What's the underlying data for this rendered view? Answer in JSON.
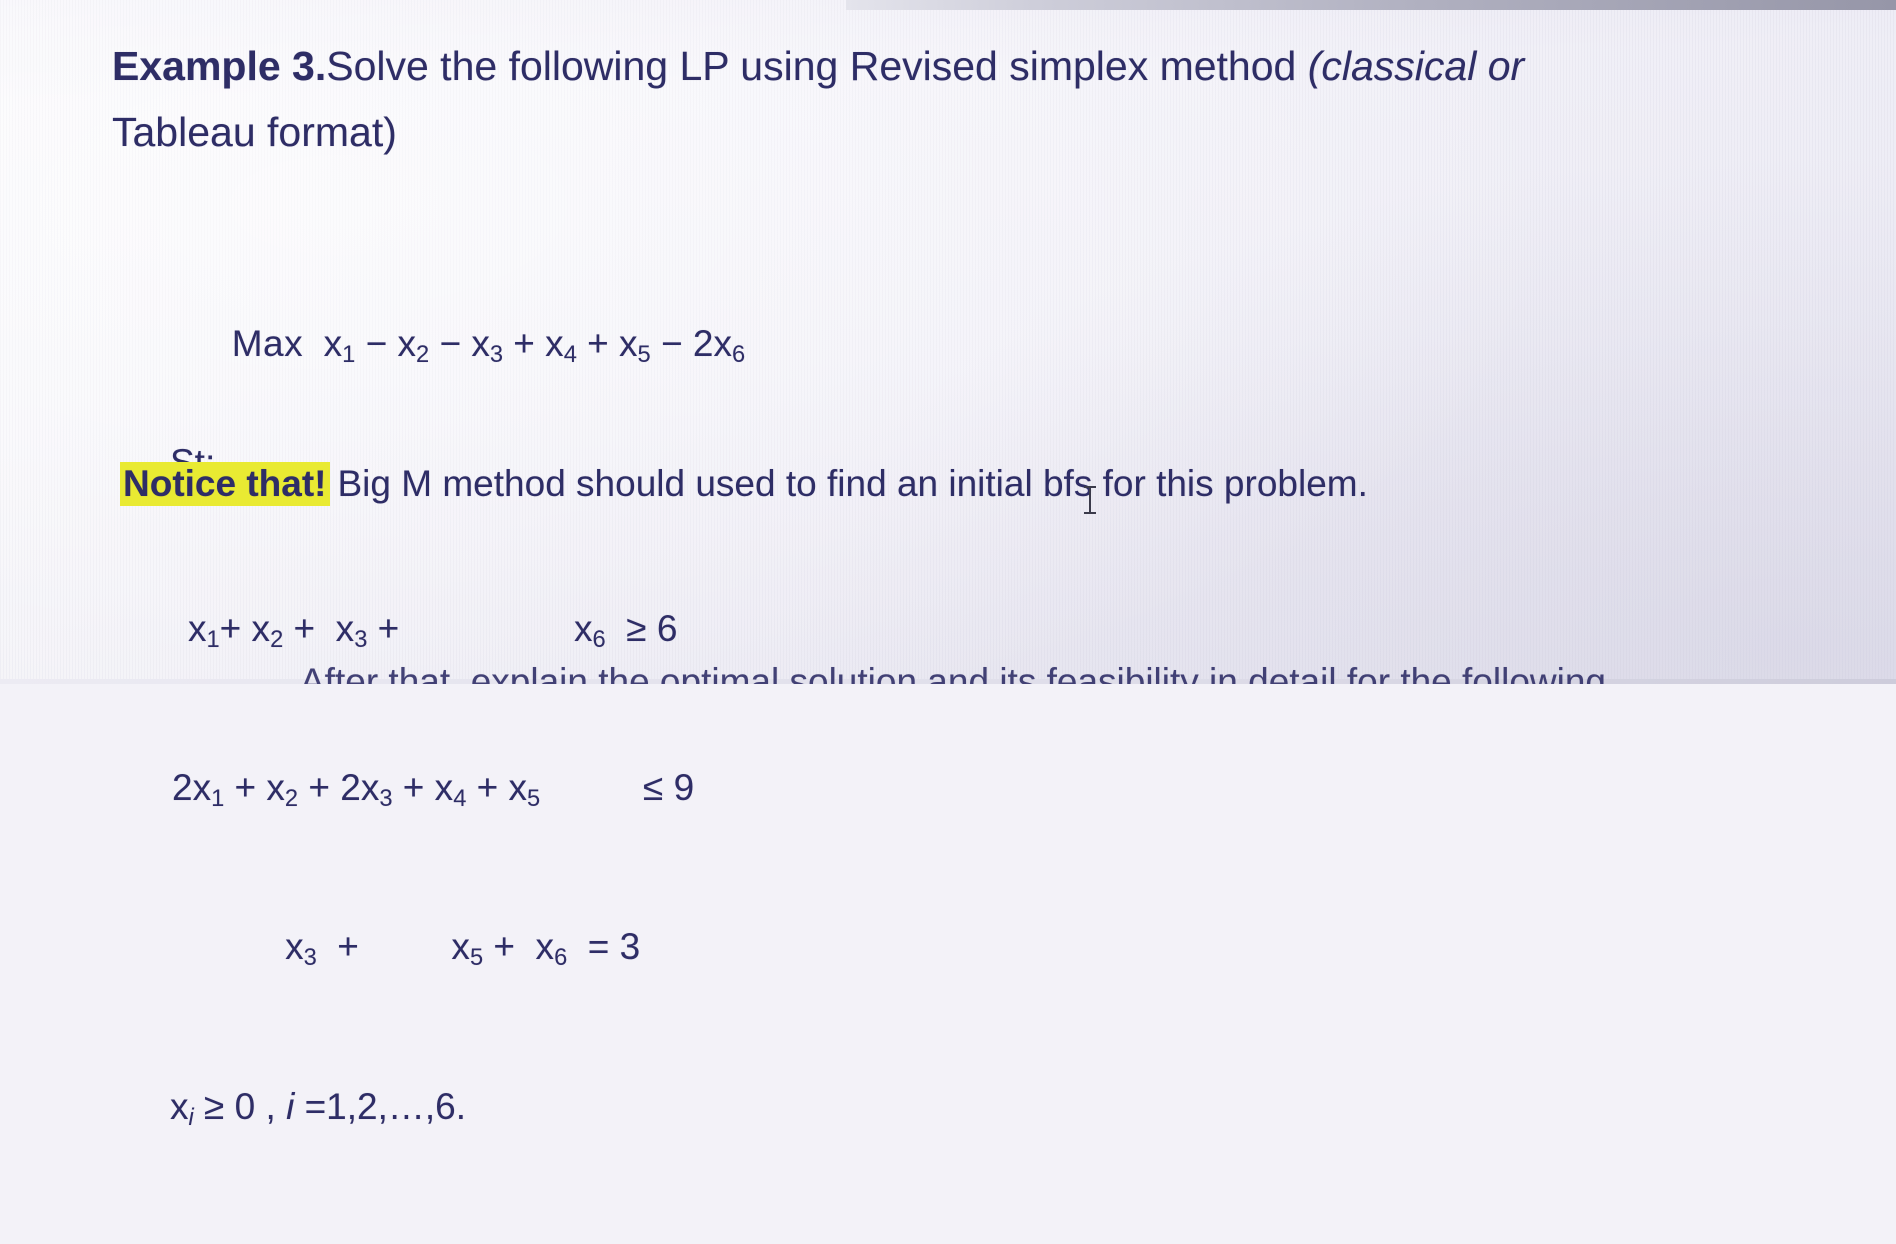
{
  "document": {
    "heading": {
      "label_bold": "Example 3.",
      "line1_rest": "Solve  the  following  LP  using  Revised  simplex  method ",
      "line1_italic_tail": "(classical  or",
      "line2": "Tableau format)"
    },
    "model": {
      "objective_label": "Max",
      "objective_terms": "x1 − x2 − x3 + x4 + x5 − 2x6",
      "subject_to_label": "St;",
      "constraint_1": "x1+ x2 +  x3 +                      x6  ≥ 6",
      "constraint_2": "2x1 + x2 + 2x3 + x4 + x5            ≤ 9",
      "constraint_3": "x3 +          x5 +  x6  = 3",
      "nonnegativity": "xi ≥ 0 , i =1,2,…,6."
    },
    "notice": {
      "highlight": "Notice that!",
      "text": "Big M method should used to find an initial bfs for this problem."
    },
    "bottom_cropped_text": "After that, explain the optimal solution and its feasibility in detail for the following",
    "colors": {
      "ink": "#2e2d66",
      "highlight": "#e9ea32",
      "background": "#f1f0f7"
    }
  }
}
